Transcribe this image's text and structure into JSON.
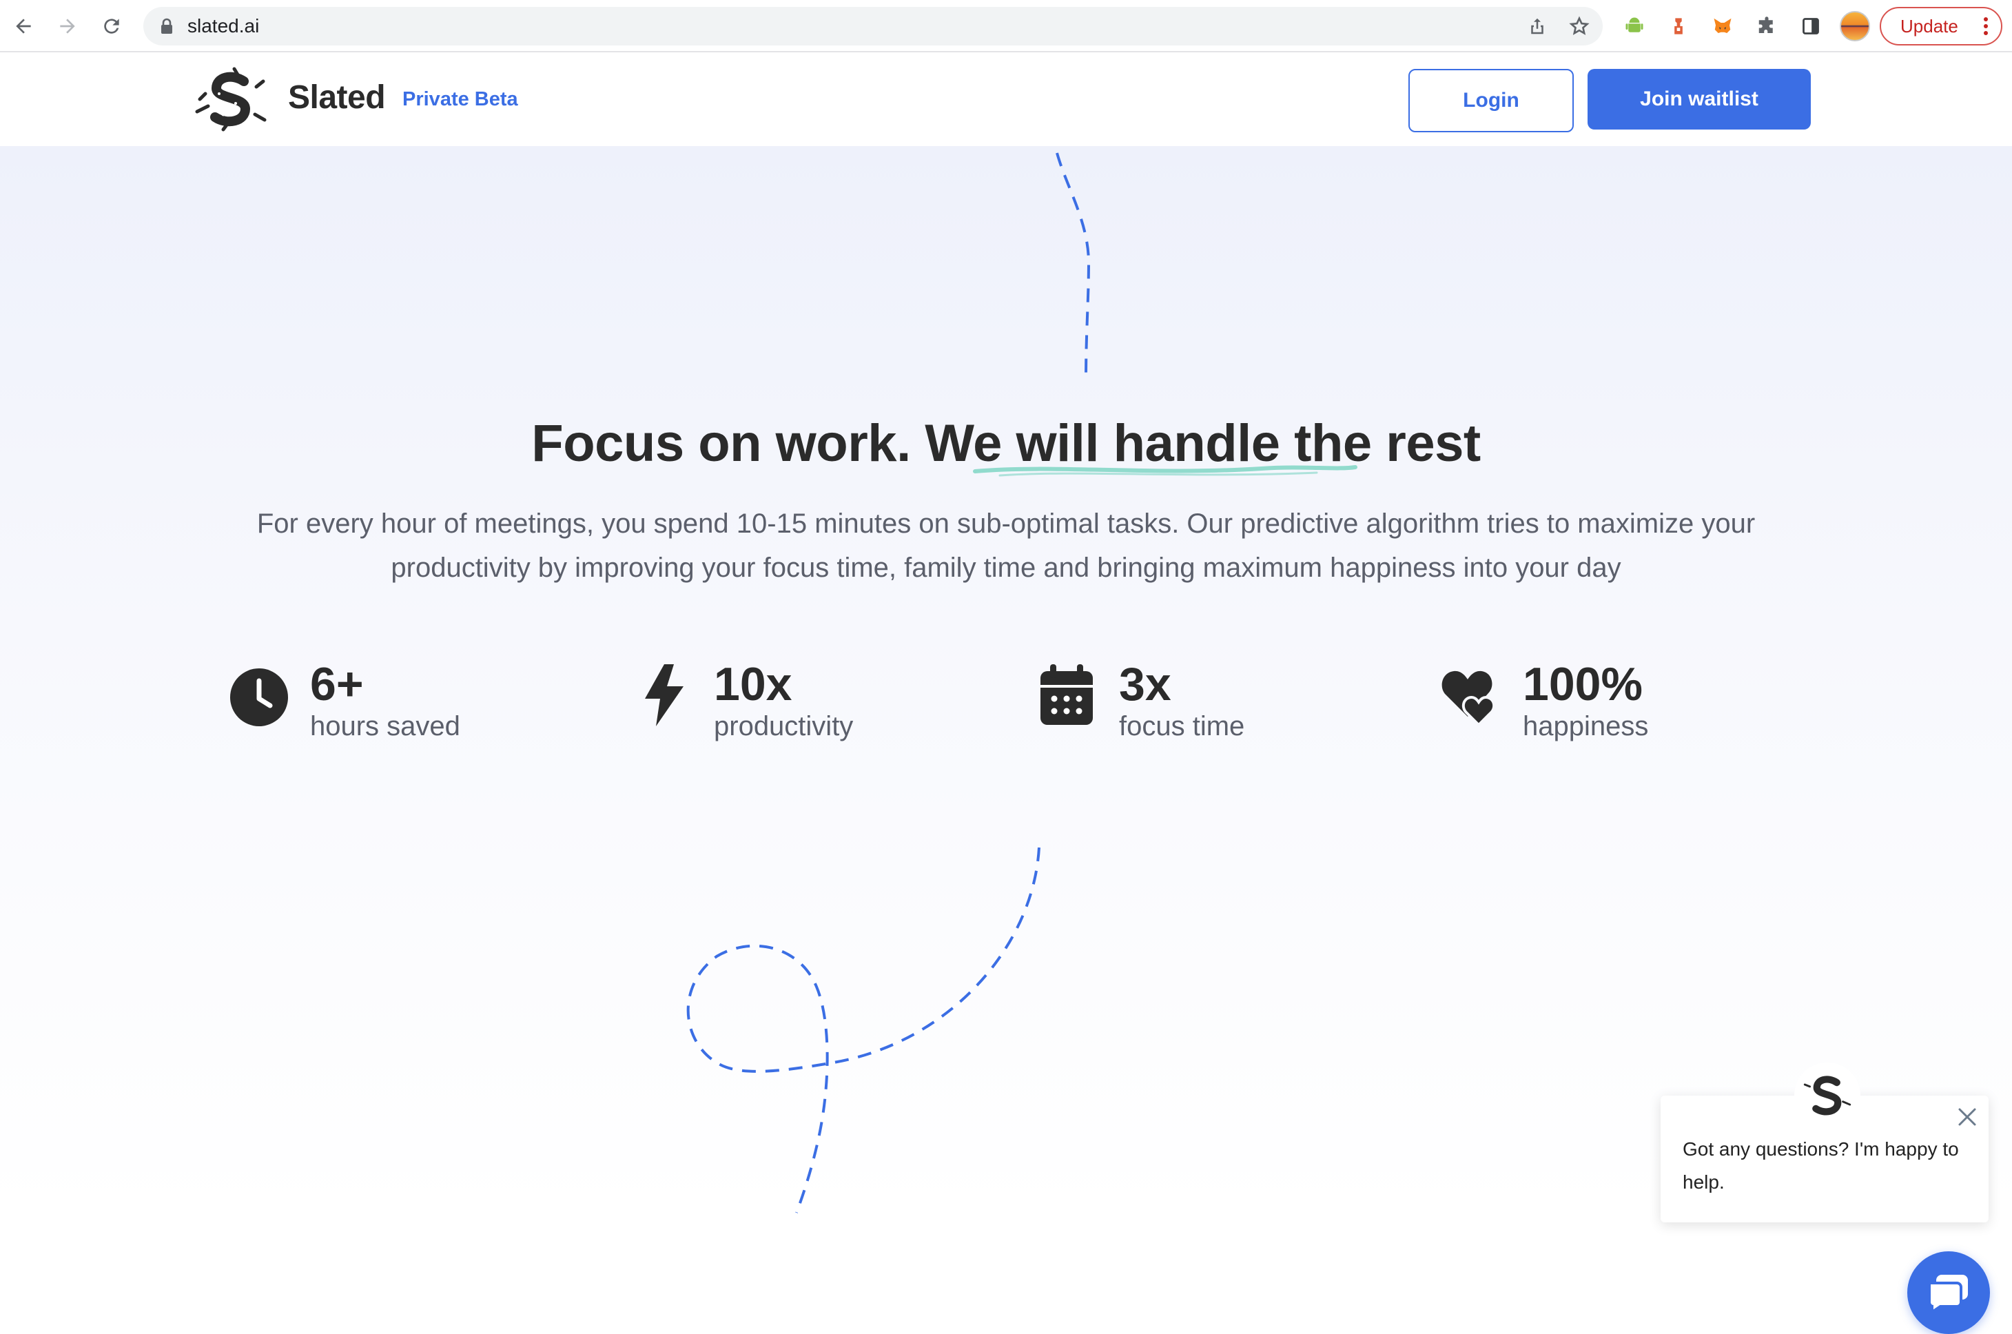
{
  "browser": {
    "url": "slated.ai",
    "update_label": "Update"
  },
  "header": {
    "brand_name": "Slated",
    "badge": "Private Beta",
    "login_label": "Login",
    "join_label": "Join waitlist"
  },
  "hero": {
    "headline": "Focus on work. We will handle the rest",
    "subtitle": "For every hour of meetings, you spend 10-15 minutes on sub-optimal tasks. Our predictive algorithm tries to maximize your productivity by improving your focus time, family time and bringing maximum happiness into your day"
  },
  "stats": [
    {
      "icon": "clock-icon",
      "value": "6+",
      "label": "hours saved"
    },
    {
      "icon": "bolt-icon",
      "value": "10x",
      "label": "productivity"
    },
    {
      "icon": "calendar-icon",
      "value": "3x",
      "label": "focus time"
    },
    {
      "icon": "hearts-icon",
      "value": "100%",
      "label": "happiness"
    }
  ],
  "chat": {
    "message": "Got any questions? I'm happy to help."
  },
  "colors": {
    "accent": "#3b6ee4",
    "text": "#2b2b2b",
    "muted": "#5b5f6b",
    "highlight": "#7fd6c4"
  }
}
